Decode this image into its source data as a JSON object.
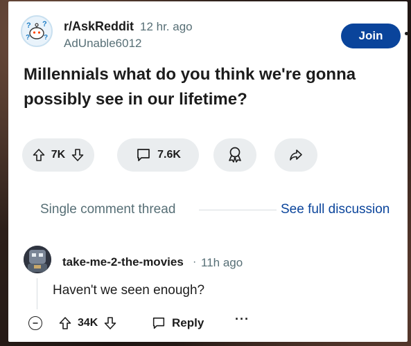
{
  "post": {
    "subreddit": "r/AskReddit",
    "time_ago": "12 hr. ago",
    "author": "AdUnable6012",
    "join_label": "Join",
    "title": "Millennials what do you think we're gonna possibly see in our lifetime?",
    "votes": "7K",
    "comments": "7.6K",
    "icons": [
      "upvote-icon",
      "downvote-icon",
      "comment-icon",
      "award-icon",
      "share-icon"
    ]
  },
  "thread": {
    "label": "Single comment thread",
    "full_discussion_label": "See full discussion"
  },
  "comment": {
    "username": "take-me-2-the-movies",
    "separator": "·",
    "time_ago": "11h ago",
    "body": "Haven't we seen enough?",
    "votes": "34K",
    "reply_label": "Reply",
    "more_label": "···"
  },
  "colors": {
    "join_button": "#0a449b",
    "link": "#0a449b",
    "pill_bg": "#eaedef",
    "meta_text": "#576f76"
  }
}
